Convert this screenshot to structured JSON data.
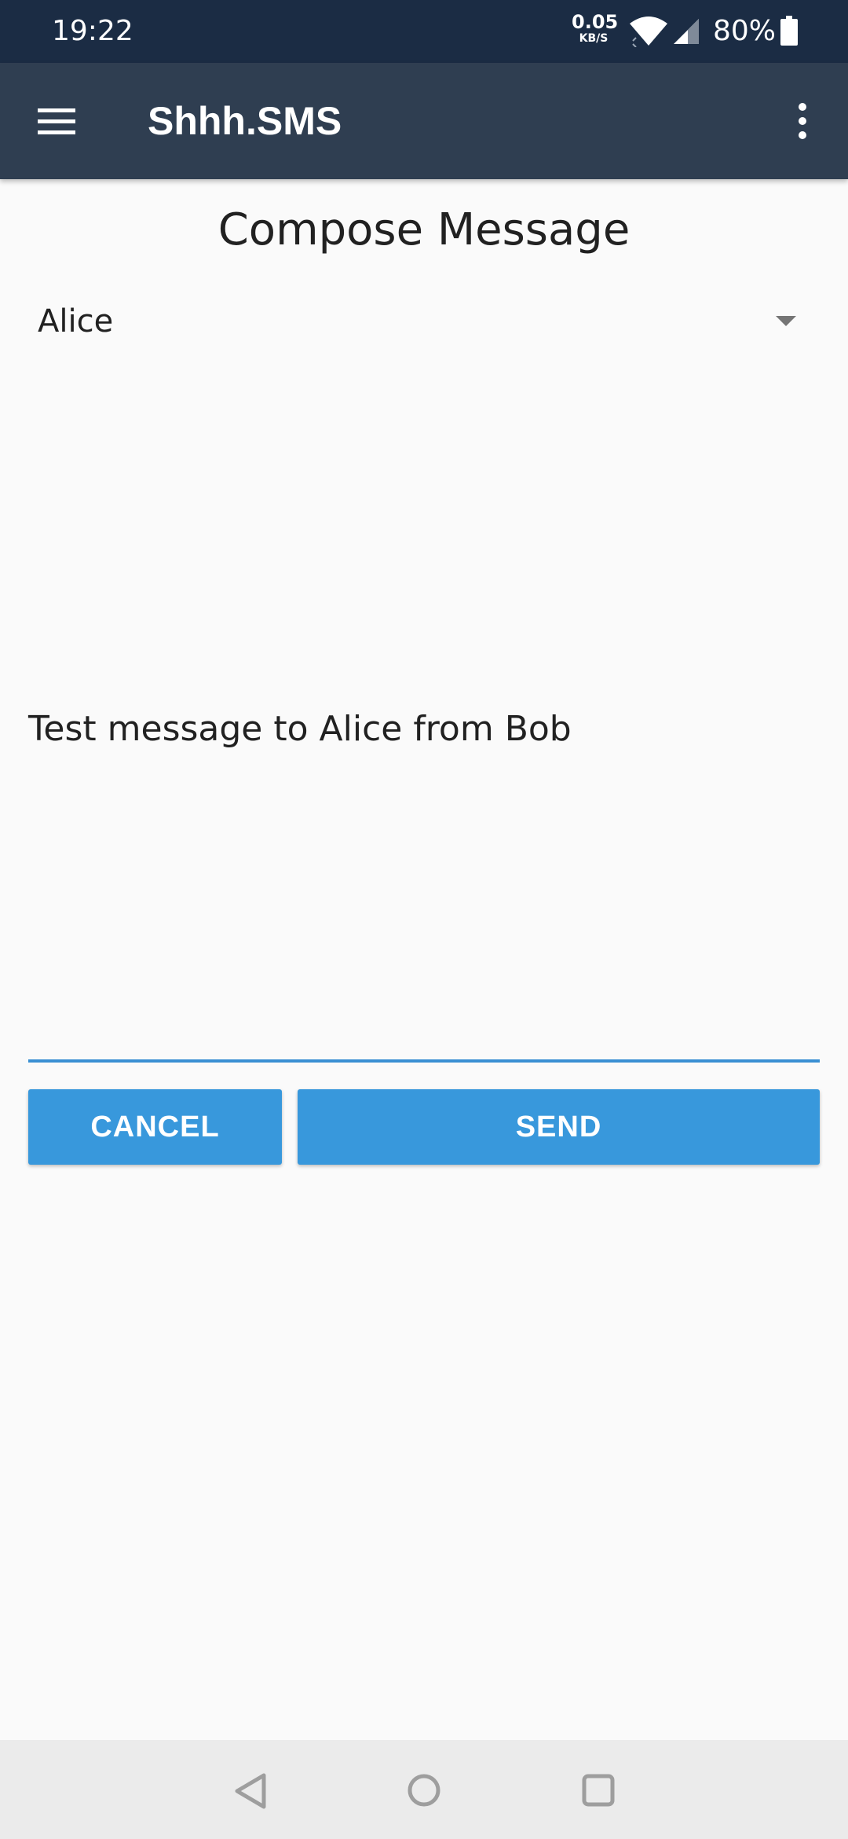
{
  "status_bar": {
    "time": "19:22",
    "net_speed_value": "0.05",
    "net_speed_unit": "KB/S",
    "battery_percent": "80%",
    "icons": [
      "wifi-icon",
      "signal-icon",
      "battery-icon"
    ]
  },
  "app_bar": {
    "title": "Shhh.SMS",
    "menu_icon": "hamburger-menu-icon",
    "overflow_icon": "more-vert-icon"
  },
  "compose": {
    "title": "Compose Message",
    "recipient": "Alice",
    "message": "Test message to Alice from Bob",
    "cancel_label": "CANCEL",
    "send_label": "SEND"
  },
  "nav_bar": {
    "icons": [
      "back-icon",
      "home-icon",
      "recents-icon"
    ]
  },
  "colors": {
    "status_bar": "#1b2c44",
    "app_bar": "#2f3e51",
    "accent": "#3898dc",
    "background": "#fafafa",
    "nav_bar": "#ebebeb"
  }
}
